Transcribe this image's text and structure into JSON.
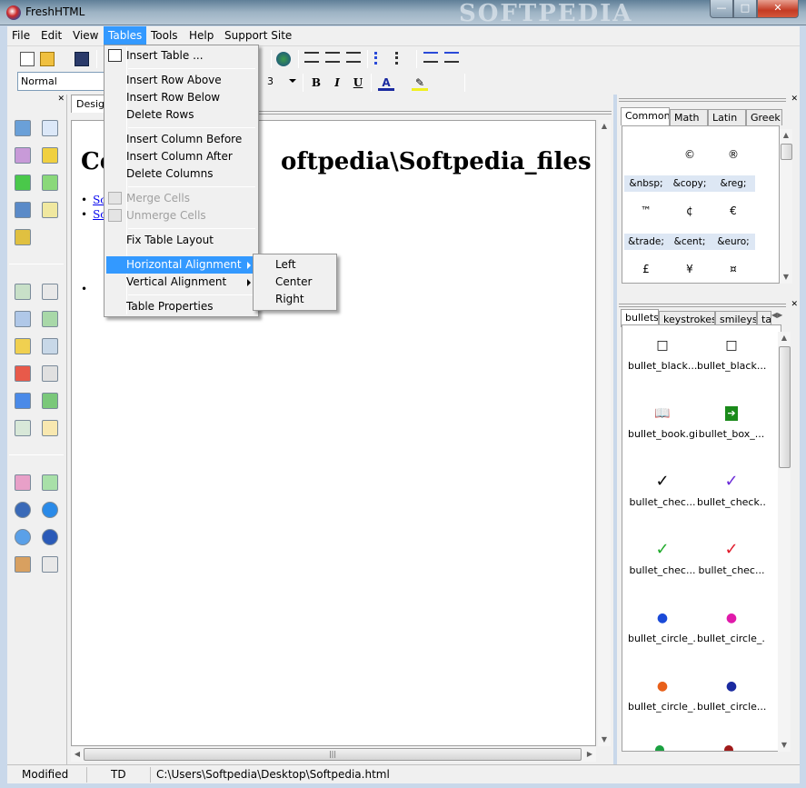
{
  "window": {
    "title": "FreshHTML",
    "watermark": "SOFTPEDIA"
  },
  "menubar": [
    "File",
    "Edit",
    "View",
    "Tables",
    "Tools",
    "Help",
    "Support Site"
  ],
  "toolbar": {
    "style_value": "Normal",
    "font_size": "3",
    "bold": "B",
    "italic": "I",
    "underline": "U"
  },
  "doc": {
    "tab": "Design",
    "heading_start": "Co",
    "heading_end": "oftpedia\\Softpedia_files",
    "links": [
      "So",
      "So"
    ]
  },
  "tables_menu": {
    "insert_table": "Insert Table ...",
    "insert_row_above": "Insert Row Above",
    "insert_row_below": "Insert Row Below",
    "delete_rows": "Delete Rows",
    "insert_column_before": "Insert Column Before",
    "insert_column_after": "Insert Column After",
    "delete_columns": "Delete Columns",
    "merge_cells": "Merge Cells",
    "unmerge_cells": "Unmerge Cells",
    "fix_table_layout": "Fix Table Layout",
    "horizontal_alignment": "Horizontal Alignment",
    "vertical_alignment": "Vertical Alignment",
    "table_properties": "Table Properties"
  },
  "halign_submenu": [
    "Left",
    "Center",
    "Right"
  ],
  "chars_panel": {
    "tabs": [
      "Common",
      "Math",
      "Latin",
      "Greek"
    ],
    "rows": [
      {
        "glyphs": [
          "",
          "©",
          "®"
        ],
        "entities": [
          "&nbsp;",
          "&copy;",
          "&reg;"
        ]
      },
      {
        "glyphs": [
          "™",
          "¢",
          "€"
        ],
        "entities": [
          "&trade;",
          "&cent;",
          "&euro;"
        ]
      },
      {
        "glyphs": [
          "£",
          "¥",
          "¤"
        ],
        "entities": []
      }
    ]
  },
  "bullets_panel": {
    "tabs": [
      "bullets",
      "keystrokes",
      "smileys",
      "ta"
    ],
    "items": [
      {
        "label": "bullet_black...",
        "glyph": "□",
        "color": "#000000"
      },
      {
        "label": "bullet_black...",
        "glyph": "□",
        "color": "#000000"
      },
      {
        "label": "bullet_book.gif",
        "glyph": "📖",
        "color": "#333333"
      },
      {
        "label": "bullet_box_...",
        "glyph": "➔",
        "color": "#1a8a1a"
      },
      {
        "label": "bullet_chec...",
        "glyph": "✓",
        "color": "#000000"
      },
      {
        "label": "bullet_check...",
        "glyph": "✓",
        "color": "#6a2ad8"
      },
      {
        "label": "bullet_chec...",
        "glyph": "✓",
        "color": "#1faa2a"
      },
      {
        "label": "bullet_chec...",
        "glyph": "✓",
        "color": "#e01a2a"
      },
      {
        "label": "bullet_circle_...",
        "glyph": "●",
        "color": "#1a4ad8"
      },
      {
        "label": "bullet_circle_...",
        "glyph": "●",
        "color": "#e01aaa"
      },
      {
        "label": "bullet_circle_...",
        "glyph": "●",
        "color": "#e8601a"
      },
      {
        "label": "bullet_circle...",
        "glyph": "●",
        "color": "#1a2aa0"
      }
    ]
  },
  "statusbar": {
    "state": "Modified",
    "tag": "TD",
    "path": "C:\\Users\\Softpedia\\Desktop\\Softpedia.html"
  }
}
